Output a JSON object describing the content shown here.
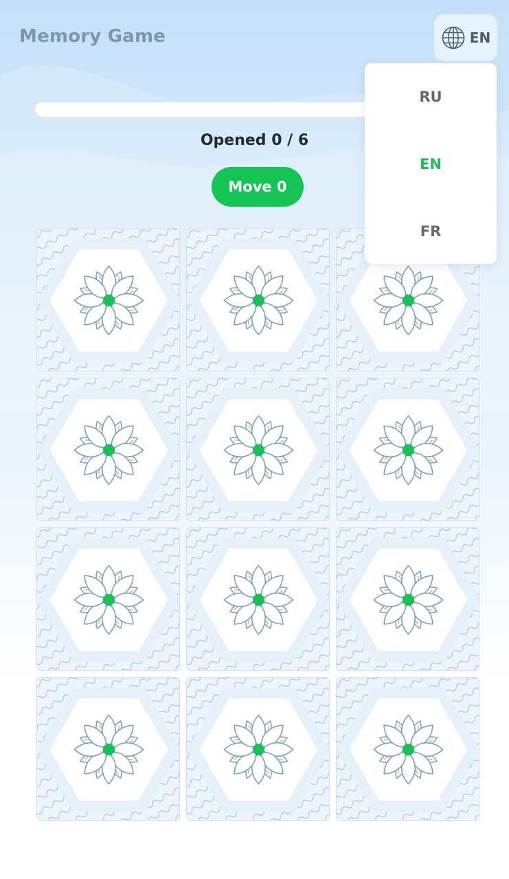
{
  "header": {
    "title": "Memory Game",
    "language_toggle": {
      "icon": "globe-icon",
      "current": "EN"
    }
  },
  "language_menu": {
    "options": [
      {
        "label": "RU",
        "active": false
      },
      {
        "label": "EN",
        "active": true
      },
      {
        "label": "FR",
        "active": false
      }
    ]
  },
  "stats": {
    "opened_label": "Opened 0 / 6",
    "opened": 0,
    "total_pairs": 6,
    "progress": 0,
    "move_label": "Move 0",
    "moves": 0
  },
  "board": {
    "columns": 3,
    "rows": 4,
    "card_back_icon": "flower-icon",
    "cards": [
      {
        "face_down": true
      },
      {
        "face_down": true
      },
      {
        "face_down": true
      },
      {
        "face_down": true
      },
      {
        "face_down": true
      },
      {
        "face_down": true
      },
      {
        "face_down": true
      },
      {
        "face_down": true
      },
      {
        "face_down": true
      },
      {
        "face_down": true
      },
      {
        "face_down": true
      },
      {
        "face_down": true
      }
    ]
  },
  "colors": {
    "accent_green": "#14c553",
    "title_gray": "#7f96ad",
    "card_line_blue": "#7a9fc0",
    "flower_center": "#19c155"
  }
}
